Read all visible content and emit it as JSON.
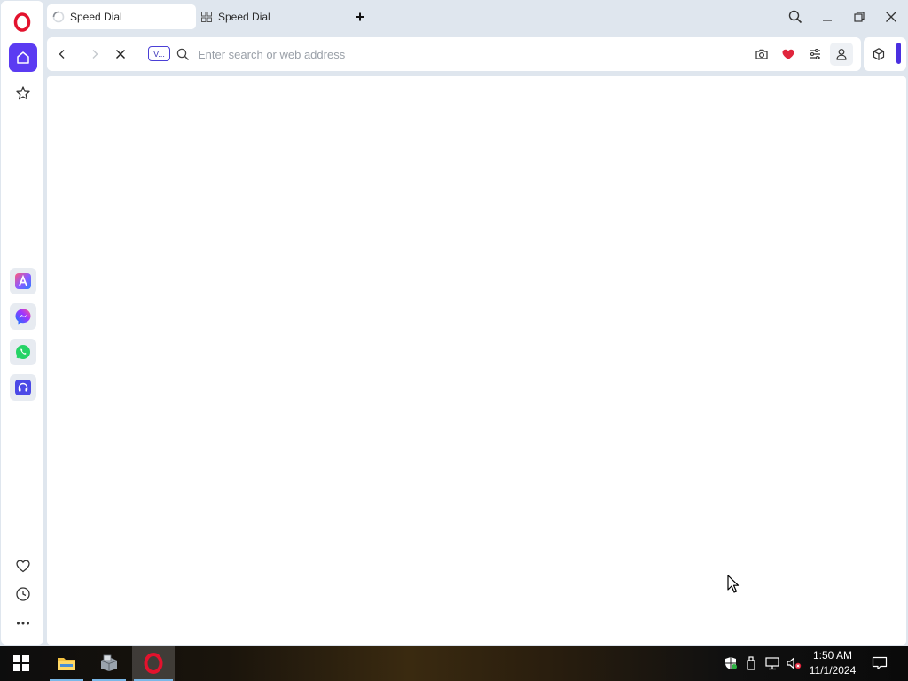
{
  "browser": {
    "tabs": [
      {
        "label": "Speed Dial",
        "state": "loading",
        "active": true
      },
      {
        "label": "Speed Dial",
        "state": "loaded",
        "active": false
      }
    ],
    "address_bar": {
      "vpn_badge": "V...",
      "placeholder": "Enter search or web address",
      "value": ""
    }
  },
  "sidebar": {
    "items": [
      {
        "name": "home",
        "icon": "home-icon"
      },
      {
        "name": "bookmarks",
        "icon": "star-icon"
      },
      {
        "name": "aria",
        "icon": "aria-icon"
      },
      {
        "name": "messenger",
        "icon": "messenger-icon"
      },
      {
        "name": "whatsapp",
        "icon": "whatsapp-icon"
      },
      {
        "name": "music-player",
        "icon": "headphones-icon"
      }
    ],
    "bottom": [
      {
        "name": "my-flow",
        "icon": "heart-icon"
      },
      {
        "name": "history",
        "icon": "clock-icon"
      },
      {
        "name": "more",
        "icon": "more-icon"
      }
    ]
  },
  "taskbar": {
    "apps": [
      {
        "name": "file-explorer",
        "icon": "folder-icon"
      },
      {
        "name": "installer",
        "icon": "box-icon"
      },
      {
        "name": "opera",
        "icon": "opera-icon"
      }
    ],
    "clock": {
      "time": "1:50 AM",
      "date": "11/1/2024"
    }
  },
  "colors": {
    "accent": "#5b3bf2",
    "opera_red": "#e3122d",
    "heart_red": "#e0253c",
    "frame": "#dfe6ee"
  }
}
